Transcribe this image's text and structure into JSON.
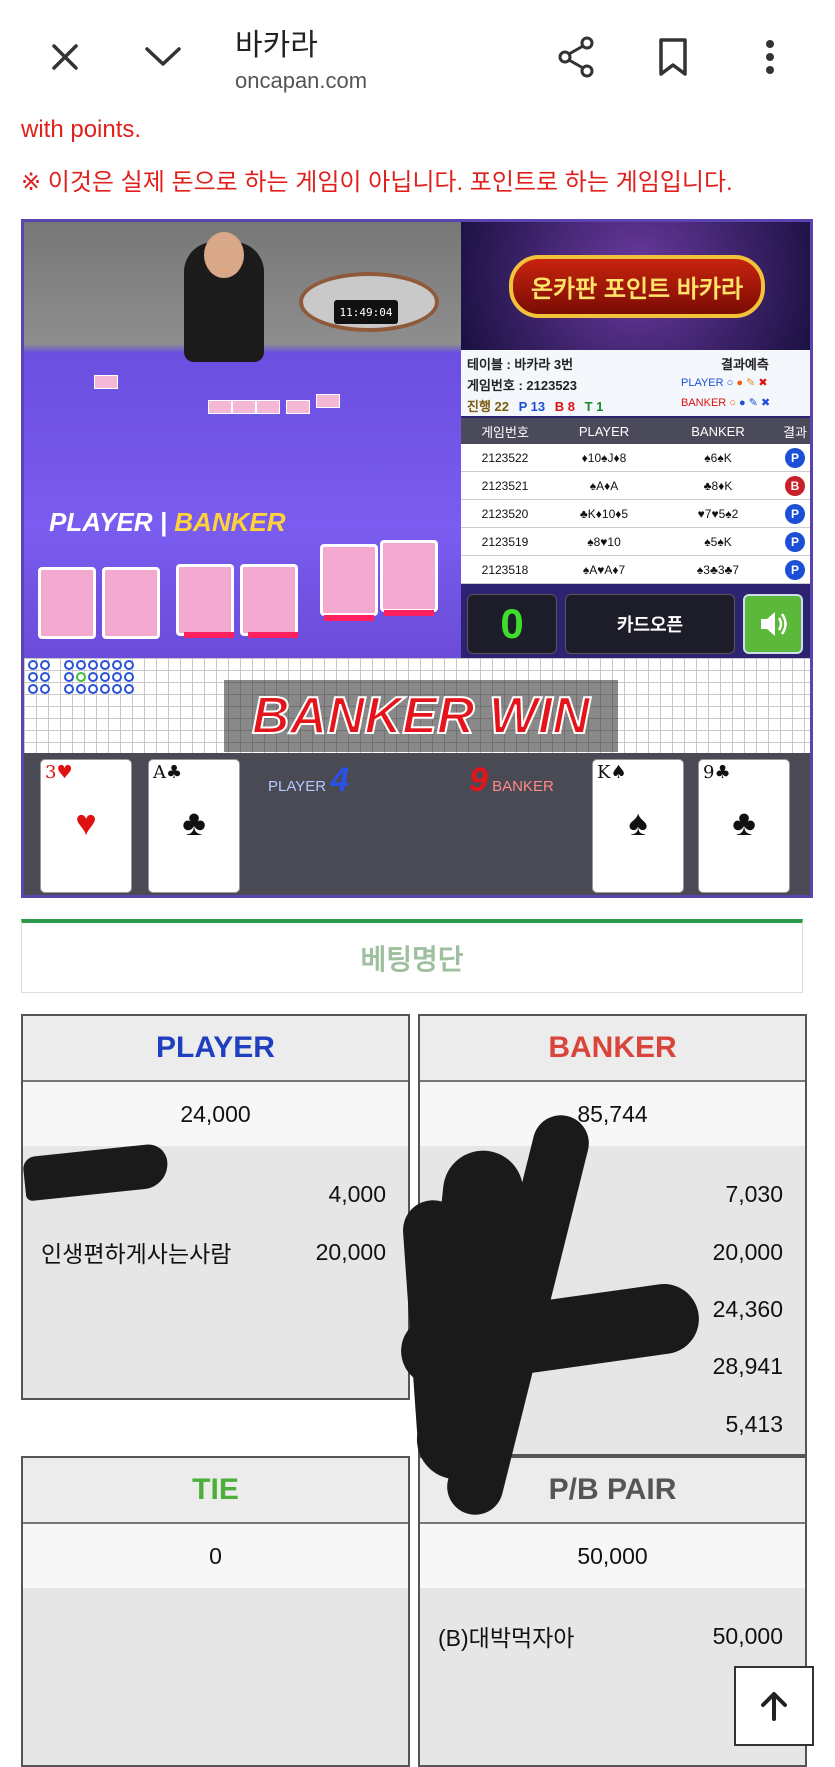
{
  "appbar": {
    "title": "바카라",
    "url": "oncapan.com",
    "icons": [
      "close-icon",
      "chevron-down-icon",
      "share-icon",
      "bookmark-icon",
      "more-vert-icon"
    ]
  },
  "notice": {
    "line1": "with points.",
    "line2": "※ 이것은 실제 돈으로 하는 게임이 아닙니다. 포인트로 하는 게임입니다."
  },
  "game": {
    "clock": "11:49:04",
    "table_label_player": "PLAYER",
    "table_label_banker": "BANKER",
    "banner": "온카판 포인트 바카라",
    "info": {
      "table": "테이블 : 바카라 3번",
      "game_no": "게임번호 : 2123523",
      "progress_label": "진행 22",
      "p": "P 13",
      "b": "B 8",
      "t": "T 1",
      "prediction": "결과예측",
      "player": "PLAYER",
      "banker": "BANKER"
    },
    "history": {
      "headers": [
        "게임번호",
        "PLAYER",
        "BANKER",
        "결과"
      ],
      "rows": [
        {
          "no": "2123522",
          "player": "♦10♠J♦8",
          "banker": "♠6♠K",
          "result": "P",
          "color": "#1d4fd6"
        },
        {
          "no": "2123521",
          "player": "♠A♦A",
          "banker": "♣8♦K",
          "result": "B",
          "color": "#c8202a"
        },
        {
          "no": "2123520",
          "player": "♣K♦10♦5",
          "banker": "♥7♥5♠2",
          "result": "P",
          "color": "#1d4fd6"
        },
        {
          "no": "2123519",
          "player": "♠8♥10",
          "banker": "♠5♠K",
          "result": "P",
          "color": "#1d4fd6"
        },
        {
          "no": "2123518",
          "player": "♠A♥A♦7",
          "banker": "♠3♣3♣7",
          "result": "P",
          "color": "#1d4fd6"
        }
      ]
    },
    "counter": "0",
    "card_open": "카드오픈",
    "win_banner": "BANKER WIN",
    "player_points_label": "PLAYER",
    "player_points": "4",
    "banker_points_label": "BANKER",
    "banker_points": "9",
    "player_cards": [
      {
        "rank": "3",
        "suit": "♥",
        "color": "#d11"
      },
      {
        "rank": "A",
        "suit": "♣",
        "color": "#111"
      }
    ],
    "banker_cards": [
      {
        "rank": "K",
        "suit": "♠",
        "color": "#111"
      },
      {
        "rank": "9",
        "suit": "♣",
        "color": "#111"
      }
    ]
  },
  "bets": {
    "title": "베팅명단",
    "player": {
      "label": "PLAYER",
      "color": "#1f3fc0",
      "total": "24,000",
      "entries": [
        {
          "name": "",
          "amount": "4,000"
        },
        {
          "name": "인생편하게사는사람",
          "amount": "20,000"
        }
      ]
    },
    "banker": {
      "label": "BANKER",
      "color": "#d9453a",
      "total": "85,744",
      "entries": [
        {
          "name": "",
          "amount": "7,030"
        },
        {
          "name": "",
          "amount": "20,000"
        },
        {
          "name": "",
          "amount": "24,360"
        },
        {
          "name": "",
          "amount": "28,941"
        },
        {
          "name": "",
          "amount": "5,413"
        }
      ]
    },
    "tie": {
      "label": "TIE",
      "color": "#4caf3a",
      "total": "0"
    },
    "pair": {
      "label": "P/B PAIR",
      "color": "#555555",
      "total": "50,000",
      "entries": [
        {
          "name": "(B)대박먹자아",
          "amount": "50,000"
        }
      ]
    }
  }
}
